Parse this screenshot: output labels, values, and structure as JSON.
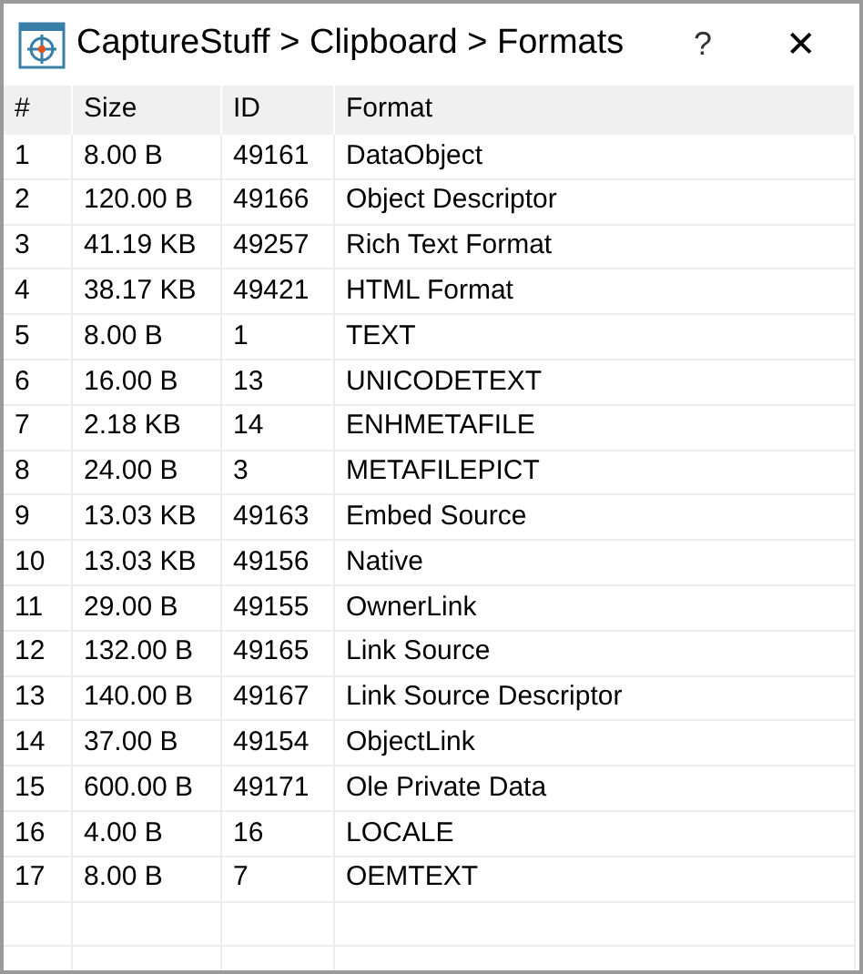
{
  "window": {
    "title": "CaptureStuff > Clipboard > Formats",
    "help": "?",
    "close": "✕"
  },
  "table": {
    "columns": [
      "#",
      "Size",
      "ID",
      "Format"
    ],
    "rows": [
      [
        "1",
        "8.00 B",
        "49161",
        "DataObject"
      ],
      [
        "2",
        "120.00 B",
        "49166",
        "Object Descriptor"
      ],
      [
        "3",
        "41.19 KB",
        "49257",
        "Rich Text Format"
      ],
      [
        "4",
        "38.17 KB",
        "49421",
        "HTML Format"
      ],
      [
        "5",
        "8.00 B",
        "1",
        "TEXT"
      ],
      [
        "6",
        "16.00 B",
        "13",
        "UNICODETEXT"
      ],
      [
        "7",
        "2.18 KB",
        "14",
        "ENHMETAFILE"
      ],
      [
        "8",
        "24.00 B",
        "3",
        "METAFILEPICT"
      ],
      [
        "9",
        "13.03 KB",
        "49163",
        "Embed Source"
      ],
      [
        "10",
        "13.03 KB",
        "49156",
        "Native"
      ],
      [
        "11",
        "29.00 B",
        "49155",
        "OwnerLink"
      ],
      [
        "12",
        "132.00 B",
        "49165",
        "Link Source"
      ],
      [
        "13",
        "140.00 B",
        "49167",
        "Link Source Descriptor"
      ],
      [
        "14",
        "37.00 B",
        "49154",
        "ObjectLink"
      ],
      [
        "15",
        "600.00 B",
        "49171",
        "Ole Private Data"
      ],
      [
        "16",
        "4.00 B",
        "16",
        "LOCALE"
      ],
      [
        "17",
        "8.00 B",
        "7",
        "OEMTEXT"
      ]
    ]
  }
}
